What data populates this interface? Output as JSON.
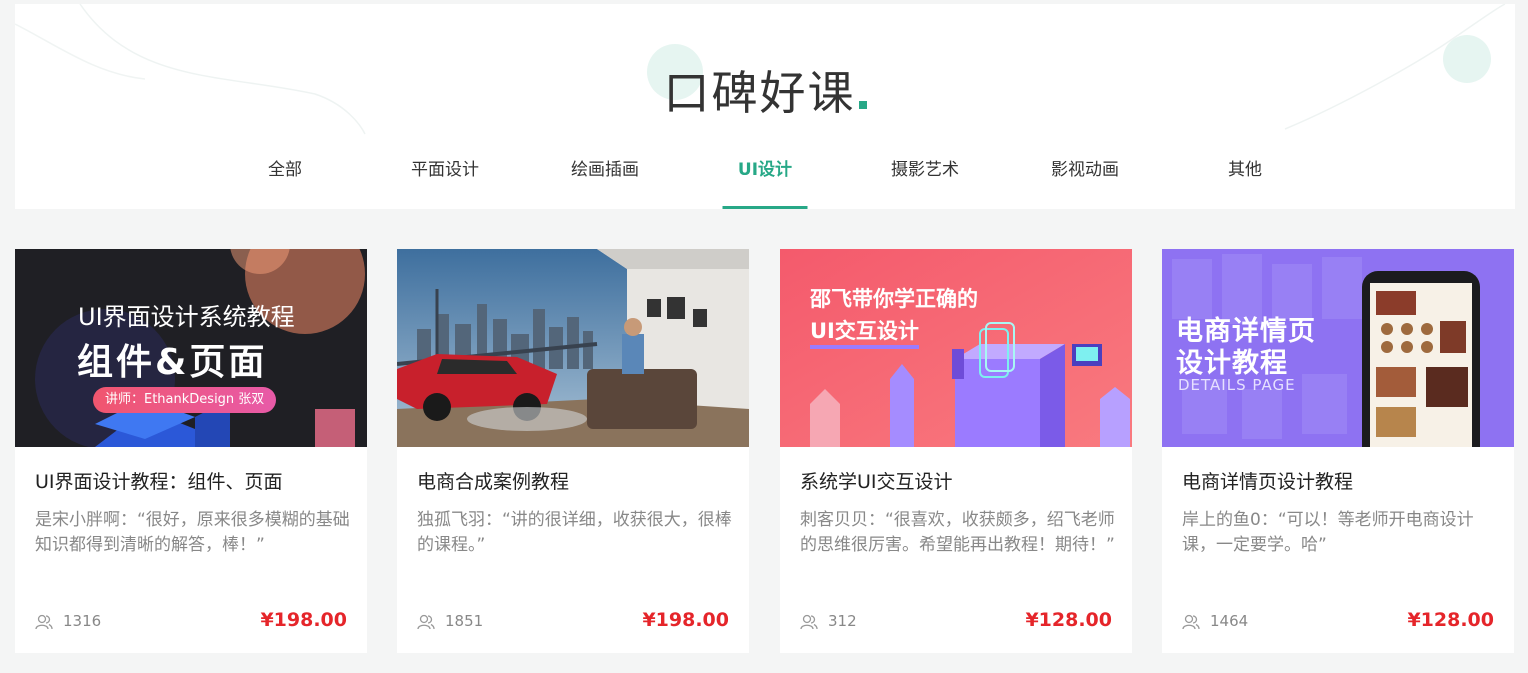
{
  "section": {
    "title": "口碑好课",
    "accent_color": "#27a887"
  },
  "tabs": [
    {
      "label": "全部",
      "active": false
    },
    {
      "label": "平面设计",
      "active": false
    },
    {
      "label": "绘画插画",
      "active": false
    },
    {
      "label": "UI设计",
      "active": true
    },
    {
      "label": "摄影艺术",
      "active": false
    },
    {
      "label": "影视动画",
      "active": false
    },
    {
      "label": "其他",
      "active": false
    }
  ],
  "courses": [
    {
      "title": "UI界面设计教程：组件、页面",
      "comment": "是宋小胖啊：“很好，原来很多模糊的基础知识都得到清晰的解答，棒！”",
      "students": "1316",
      "price": "¥198.00",
      "thumb": {
        "line1": "UI界面设计系统教程",
        "line2": "组件&页面",
        "badge": "讲师：EthankDesign 张双"
      }
    },
    {
      "title": "电商合成案例教程",
      "comment": "独孤飞羽：“讲的很详细，收获很大，很棒的课程。”",
      "students": "1851",
      "price": "¥198.00",
      "thumb": {}
    },
    {
      "title": "系统学UI交互设计",
      "comment": "刺客贝贝：“很喜欢，收获颇多，绍飞老师的思维很厉害。希望能再出教程！期待！”",
      "students": "312",
      "price": "¥128.00",
      "thumb": {
        "line1": "邵飞带你学正确的",
        "line2": "UI交互设计"
      }
    },
    {
      "title": "电商详情页设计教程",
      "comment": "岸上的鱼0：“可以！等老师开电商设计课，一定要学。哈”",
      "students": "1464",
      "price": "¥128.00",
      "thumb": {
        "line1": "电商详情页",
        "line2": "设计教程",
        "line3": "DETAILS PAGE"
      }
    }
  ],
  "colors": {
    "price": "#e5252a",
    "muted": "#888888",
    "background": "#f4f5f5"
  },
  "icons": {
    "students": "people-icon"
  }
}
